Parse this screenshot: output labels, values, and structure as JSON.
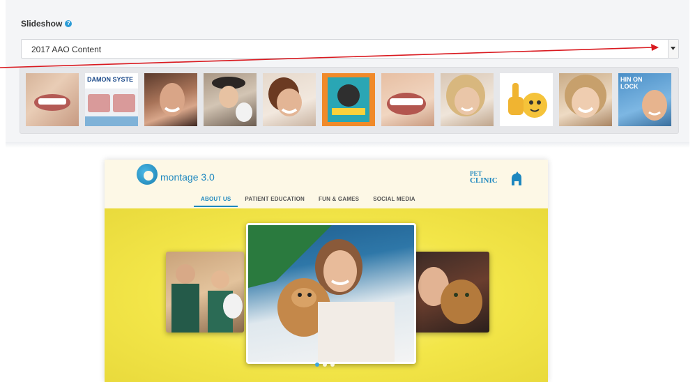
{
  "slideshow": {
    "label": "Slideshow",
    "help_icon": "info-circle-icon",
    "selected": "2017 AAO Content",
    "thumbnails": [
      {
        "name": "smile-closeup-thumb",
        "caption": ""
      },
      {
        "name": "damon-system-thumb",
        "caption": "DAMON SYSTE"
      },
      {
        "name": "smiling-woman-thumb",
        "caption": ""
      },
      {
        "name": "woman-with-hat-thumb",
        "caption": ""
      },
      {
        "name": "woman-portrait-thumb",
        "caption": ""
      },
      {
        "name": "retro-poster-thumb",
        "caption": ""
      },
      {
        "name": "big-smile-thumb",
        "caption": ""
      },
      {
        "name": "blonde-woman-thumb",
        "caption": ""
      },
      {
        "name": "thumbs-up-emoji-thumb",
        "caption": ""
      },
      {
        "name": "laughing-woman-thumb",
        "caption": ""
      },
      {
        "name": "boy-smiling-thumb",
        "caption": "HIN ON LOCK"
      }
    ]
  },
  "mockup": {
    "logo_text": "montage 3.0",
    "partner_logo": "PET CLINIC",
    "nav": [
      {
        "label": "ABOUT US",
        "active": true
      },
      {
        "label": "PATIENT EDUCATION",
        "active": false
      },
      {
        "label": "FUN & GAMES",
        "active": false
      },
      {
        "label": "SOCIAL MEDIA",
        "active": false
      }
    ],
    "slides": [
      "vet-team-slide",
      "woman-with-dog-slide",
      "woman-with-cat-slide"
    ],
    "carousel_dots": 3,
    "active_dot": 0
  },
  "colors": {
    "accent": "#1d87bf",
    "annotation_arrow": "#d9191f",
    "hero_yellow": "#f3e649"
  }
}
